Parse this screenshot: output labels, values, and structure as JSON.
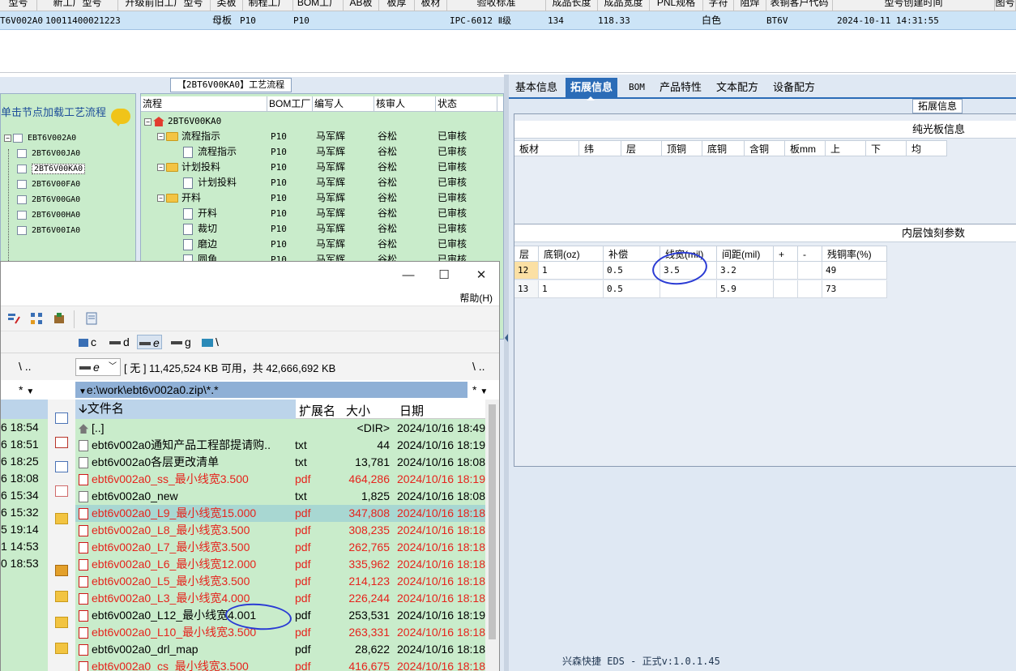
{
  "top_grid": {
    "header": [
      "型号",
      "新工厂型号",
      "升级前旧工厂型号",
      "类板",
      "制程工厂",
      "BOM工厂",
      "AB板",
      "板厚",
      "板材",
      "验收标准",
      "成品长度",
      "成品宽度",
      "PNL规格",
      "字符",
      "阻焊",
      "表铜客户代码",
      "型号创建时间",
      "图号"
    ],
    "row": {
      "model": "T6V002A0",
      "code": "10011400021223",
      "board_type": "母板",
      "process_factory": "P10",
      "bom_factory": "P10",
      "standard": "IPC-6012 Ⅱ级",
      "length": "134",
      "width": "118.33",
      "silkscreen": "白色",
      "customer_code": "BT6V",
      "created": "2024-10-11 14:31:55"
    }
  },
  "process": {
    "title": "【2BT6V00KA0】工艺流程",
    "tree_caption": "单击节点加载工艺流程",
    "tree_items": [
      "EBT6V002A0",
      "2BT6V00JA0",
      "2BT6V00KA0",
      "2BT6V00FA0",
      "2BT6V00GA0",
      "2BT6V00HA0",
      "2BT6V00IA0"
    ],
    "columns": [
      "流程",
      "BOM工厂",
      "编写人",
      "核审人",
      "状态"
    ],
    "root": "2BT6V00KA0",
    "rows": [
      {
        "name": "流程指示",
        "factory": "P10",
        "writer": "马军辉",
        "reviewer": "谷松",
        "status": "已审核"
      },
      {
        "name": "流程指示",
        "factory": "P10",
        "writer": "马军辉",
        "reviewer": "谷松",
        "status": "已审核"
      },
      {
        "name": "计划投料",
        "factory": "P10",
        "writer": "马军辉",
        "reviewer": "谷松",
        "status": "已审核"
      },
      {
        "name": "计划投料",
        "factory": "P10",
        "writer": "马军辉",
        "reviewer": "谷松",
        "status": "已审核"
      },
      {
        "name": "开料",
        "factory": "P10",
        "writer": "马军辉",
        "reviewer": "谷松",
        "status": "已审核"
      },
      {
        "name": "开料",
        "factory": "P10",
        "writer": "马军辉",
        "reviewer": "谷松",
        "status": "已审核"
      },
      {
        "name": "裁切",
        "factory": "P10",
        "writer": "马军辉",
        "reviewer": "谷松",
        "status": "已审核"
      },
      {
        "name": "磨边",
        "factory": "P10",
        "writer": "马军辉",
        "reviewer": "谷松",
        "status": "已审核"
      },
      {
        "name": "圆角",
        "factory": "P10",
        "writer": "马军辉",
        "reviewer": "谷松",
        "status": "已审核"
      }
    ]
  },
  "file_manager": {
    "help_menu": "帮助(H)",
    "minimize": "—",
    "maximize": "☐",
    "close": "✕",
    "drives": [
      "c",
      "d",
      "e",
      "g",
      "\\"
    ],
    "drive_select": "e",
    "free_space": "[ 无 ]  11,425,524 KB 可用，共 42,666,692 KB",
    "left_nav": "\\  ..",
    "right_nav": "\\  ..",
    "star": "*",
    "current_path": "e:\\work\\ebt6v002a0.zip\\*.*",
    "columns": {
      "name": "🡫文件名",
      "ext": "扩展名",
      "size": "大小",
      "date": "日期"
    },
    "left_times": [
      "6 18:54",
      "6 18:51",
      "6 18:25",
      "6 18:08",
      "6 15:34",
      "6 15:32",
      "5 19:14",
      "1 14:53",
      "0 18:53"
    ],
    "files": [
      {
        "name": "[..]",
        "ext": "",
        "size": "<DIR>",
        "date": "2024/10/16 18:49",
        "type": "up",
        "red": false
      },
      {
        "name": "ebt6v002a0通知产品工程部提请购..",
        "ext": "txt",
        "size": "44",
        "date": "2024/10/16 18:19",
        "type": "txt",
        "red": false
      },
      {
        "name": "ebt6v002a0各层更改清单",
        "ext": "txt",
        "size": "13,781",
        "date": "2024/10/16 18:08",
        "type": "txt",
        "red": false
      },
      {
        "name": "ebt6v002a0_ss_最小线宽3.500",
        "ext": "pdf",
        "size": "464,286",
        "date": "2024/10/16 18:19",
        "type": "pdf",
        "red": true
      },
      {
        "name": "ebt6v002a0_new",
        "ext": "txt",
        "size": "1,825",
        "date": "2024/10/16 18:08",
        "type": "txt",
        "red": false
      },
      {
        "name": "ebt6v002a0_L9_最小线宽15.000",
        "ext": "pdf",
        "size": "347,808",
        "date": "2024/10/16 18:18",
        "type": "pdf",
        "red": true
      },
      {
        "name": "ebt6v002a0_L8_最小线宽3.500",
        "ext": "pdf",
        "size": "308,235",
        "date": "2024/10/16 18:18",
        "type": "pdf",
        "red": true
      },
      {
        "name": "ebt6v002a0_L7_最小线宽3.500",
        "ext": "pdf",
        "size": "262,765",
        "date": "2024/10/16 18:18",
        "type": "pdf",
        "red": true
      },
      {
        "name": "ebt6v002a0_L6_最小线宽12.000",
        "ext": "pdf",
        "size": "335,962",
        "date": "2024/10/16 18:18",
        "type": "pdf",
        "red": true
      },
      {
        "name": "ebt6v002a0_L5_最小线宽3.500",
        "ext": "pdf",
        "size": "214,123",
        "date": "2024/10/16 18:18",
        "type": "pdf",
        "red": true
      },
      {
        "name": "ebt6v002a0_L3_最小线宽4.000",
        "ext": "pdf",
        "size": "226,244",
        "date": "2024/10/16 18:18",
        "type": "pdf",
        "red": true
      },
      {
        "name": "ebt6v002a0_L12_最小线宽4.001",
        "ext": "pdf",
        "size": "253,531",
        "date": "2024/10/16 18:19",
        "type": "pdf",
        "red": false
      },
      {
        "name": "ebt6v002a0_L10_最小线宽3.500",
        "ext": "pdf",
        "size": "263,331",
        "date": "2024/10/16 18:18",
        "type": "pdf",
        "red": true
      },
      {
        "name": "ebt6v002a0_drl_map",
        "ext": "pdf",
        "size": "28,622",
        "date": "2024/10/16 18:18",
        "type": "pdf",
        "red": false
      },
      {
        "name": "ebt6v002a0_cs_最小线宽3.500",
        "ext": "pdf",
        "size": "416,675",
        "date": "2024/10/16 18:18",
        "type": "pdf",
        "red": true
      }
    ]
  },
  "right": {
    "tabs": [
      "基本信息",
      "拓展信息",
      "BOM",
      "产品特性",
      "文本配方",
      "设备配方"
    ],
    "ext_label": "拓展信息",
    "section1_title": "纯光板信息",
    "section1_cols": [
      "板材",
      "纬",
      "层",
      "顶铜",
      "底铜",
      "含铜",
      "板mm",
      "上",
      "下",
      "均"
    ],
    "section2_title": "内层蚀刻参数",
    "section2_cols": [
      "层",
      "底铜(oz)",
      "补偿",
      "线宽(mil)",
      "间距(mil)",
      "+",
      "-",
      "残铜率(%)"
    ],
    "section2_rows": [
      [
        "12",
        "1",
        "0.5",
        "3.5",
        "3.2",
        "",
        "",
        "49"
      ],
      [
        "13",
        "1",
        "0.5",
        "",
        "5.9",
        "",
        "",
        "73"
      ]
    ]
  },
  "status": {
    "text": "兴森快捷 EDS - 正式v:1.0.1.45"
  },
  "colors": {
    "tree_bg": "#c9eccb",
    "tab_active": "#2b6cb7",
    "selected_row": "#cce4f7",
    "red_file": "#e6231c",
    "annotation": "#2a3bd4"
  }
}
